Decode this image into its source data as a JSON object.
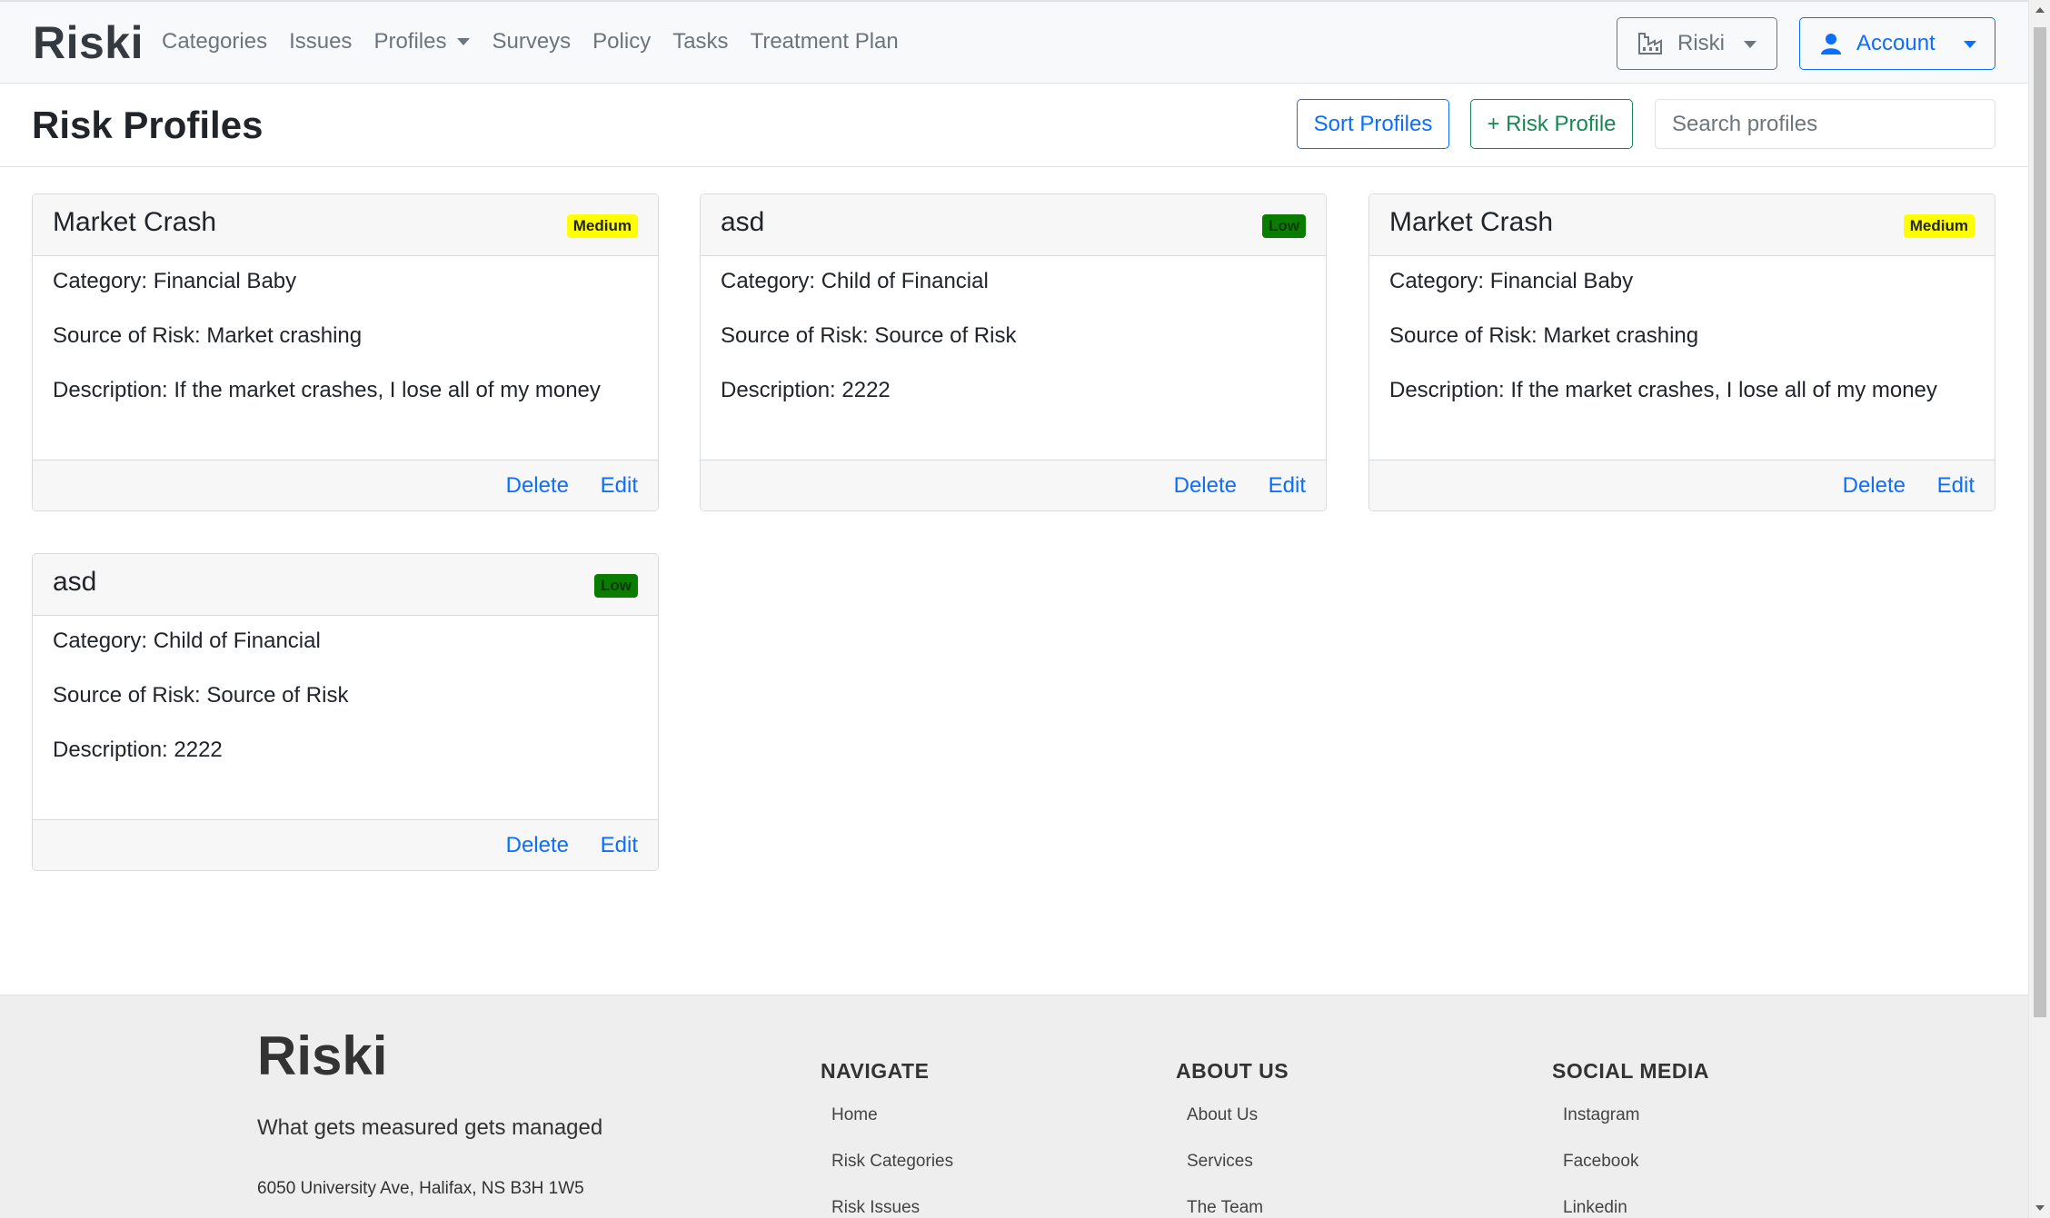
{
  "nav": {
    "brand": "Riski",
    "links": [
      "Categories",
      "Issues",
      "Profiles",
      "Surveys",
      "Policy",
      "Tasks",
      "Treatment Plan"
    ],
    "org_button": "Riski",
    "account_button": "Account"
  },
  "page": {
    "title": "Risk Profiles",
    "sort_button": "Sort Profiles",
    "add_button": "+ Risk Profile",
    "search_placeholder": "Search profiles"
  },
  "cards": [
    {
      "title": "Market Crash",
      "badge": "Medium",
      "level": "medium",
      "category": "Category: Financial Baby",
      "source": "Source of Risk: Market crashing",
      "description": "Description: If the market crashes, I lose all of my money",
      "delete": "Delete",
      "edit": "Edit"
    },
    {
      "title": "asd",
      "badge": "Low",
      "level": "low",
      "category": "Category: Child of Financial",
      "source": "Source of Risk: Source of Risk",
      "description": "Description: 2222",
      "delete": "Delete",
      "edit": "Edit"
    },
    {
      "title": "Market Crash",
      "badge": "Medium",
      "level": "medium",
      "category": "Category: Financial Baby",
      "source": "Source of Risk: Market crashing",
      "description": "Description: If the market crashes, I lose all of my money",
      "delete": "Delete",
      "edit": "Edit"
    },
    {
      "title": "asd",
      "badge": "Low",
      "level": "low",
      "category": "Category: Child of Financial",
      "source": "Source of Risk: Source of Risk",
      "description": "Description: 2222",
      "delete": "Delete",
      "edit": "Edit"
    }
  ],
  "footer": {
    "brand": "Riski",
    "tagline": "What gets measured gets managed",
    "address": "6050 University Ave, Halifax, NS B3H 1W5",
    "navigate": {
      "heading": "NAVIGATE",
      "links": [
        "Home",
        "Risk Categories",
        "Risk Issues"
      ]
    },
    "about": {
      "heading": "ABOUT US",
      "links": [
        "About Us",
        "Services",
        "The Team"
      ]
    },
    "social": {
      "heading": "SOCIAL MEDIA",
      "links": [
        "Instagram",
        "Facebook",
        "Linkedin"
      ]
    }
  },
  "colors": {
    "primary": "#0d6efd",
    "success": "#198754",
    "medium_badge": "#ffff00",
    "low_badge": "#0a7d00"
  }
}
